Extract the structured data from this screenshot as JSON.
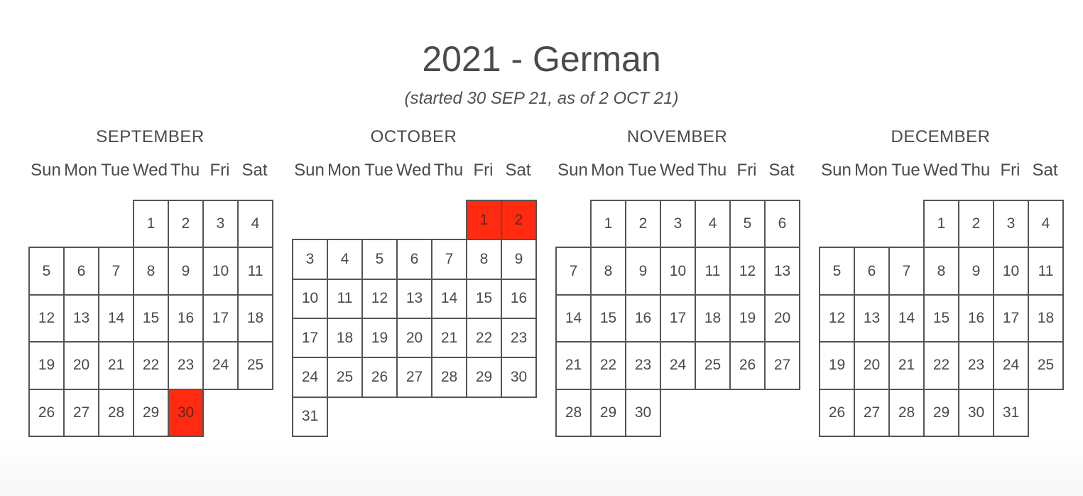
{
  "title": "2021 - German",
  "subtitle": "(started 30 SEP 21, as of 2 OCT 21)",
  "colors": {
    "highlight": "#ff2a10",
    "border": "#555555",
    "text": "#4a4a4a"
  },
  "weekdays": [
    "Sun",
    "Mon",
    "Tue",
    "Wed",
    "Thu",
    "Fri",
    "Sat"
  ],
  "months": [
    {
      "name": "SEPTEMBER",
      "first_weekday": 3,
      "days": 30,
      "highlighted": [
        30
      ]
    },
    {
      "name": "OCTOBER",
      "first_weekday": 5,
      "days": 31,
      "highlighted": [
        1,
        2
      ]
    },
    {
      "name": "NOVEMBER",
      "first_weekday": 1,
      "days": 30,
      "highlighted": []
    },
    {
      "name": "DECEMBER",
      "first_weekday": 3,
      "days": 31,
      "highlighted": []
    }
  ]
}
